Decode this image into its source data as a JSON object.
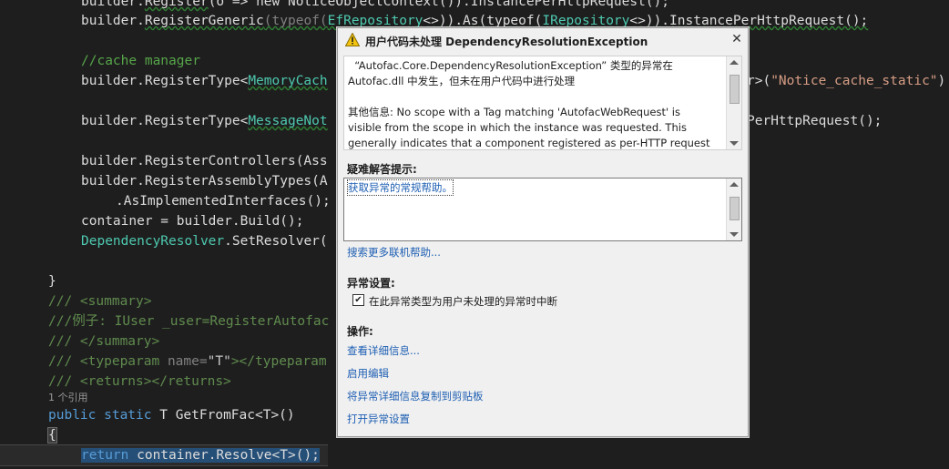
{
  "code": {
    "l1_pre": "builder.",
    "l1_m": "Register",
    "l1_rest": "(o => new NoticeObjectContext()).InstancePerHttpRequest();",
    "l2_pre": "builder.",
    "l2_m": "RegisterGeneric",
    "l2_a": "(typeof(",
    "l2_t1": "EfRepository",
    "l2_b": "<>)).As(typeof(",
    "l2_t2": "IRepository",
    "l2_c": "<>)).InstancePerHttpRequest();",
    "l3": "//cache manager",
    "l4_pre": "builder.RegisterType<",
    "l4_t": "MemoryCach",
    "l4_tail_a": "r>(",
    "l4_str": "\"Notice_cache_static\"",
    "l4_tail_b": ")",
    "l5_pre": "builder.RegisterType<",
    "l5_t": "MessageNot",
    "l5_tail": "PerHttpRequest();",
    "l6": "builder.RegisterControllers(Ass",
    "l7": "builder.RegisterAssemblyTypes(A",
    "l8": ".AsImplementedInterfaces();",
    "l9": "container = builder.Build();",
    "l10_t": "DependencyResolver",
    "l10_rest": ".SetResolver(",
    "l11": "}",
    "l12": "/// <summary>",
    "l13": "///例子: IUser _user=RegisterAutofac",
    "l14": "/// </summary>",
    "l15_a": "/// <typeparam ",
    "l15_b": "name=",
    "l15_c": "\"T\"",
    "l15_d": "></typeparam",
    "l16": "/// <returns></returns>",
    "refs": "1 个引用",
    "l17_kw": "public static",
    "l17_rest": " T GetFromFac<T>()",
    "l18": "{",
    "l19_kw": "return",
    "l19_rest": " container.Resolve<T>();"
  },
  "dialog": {
    "title": "用户代码未处理 DependencyResolutionException",
    "message_lines": [
      "  “Autofac.Core.DependencyResolutionException” 类型的异常在",
      "Autofac.dll 中发生，但未在用户代码中进行处理",
      "",
      "其他信息: No scope with a Tag matching 'AutofacWebRequest' is",
      "visible from the scope in which the instance was requested. This",
      "generally indicates that a component registered as per-HTTP request"
    ],
    "tips_heading": "疑难解答提示:",
    "tip_link": "获取异常的常规帮助。",
    "search_link": "搜索更多联机帮助...",
    "settings_heading": "异常设置:",
    "checkbox_label": "在此异常类型为用户未处理的异常时中断",
    "checkbox_checked": true,
    "actions_heading": "操作:",
    "actions": [
      "查看详细信息...",
      "启用编辑",
      "将异常详细信息复制到剪贴板",
      "打开异常设置"
    ]
  }
}
